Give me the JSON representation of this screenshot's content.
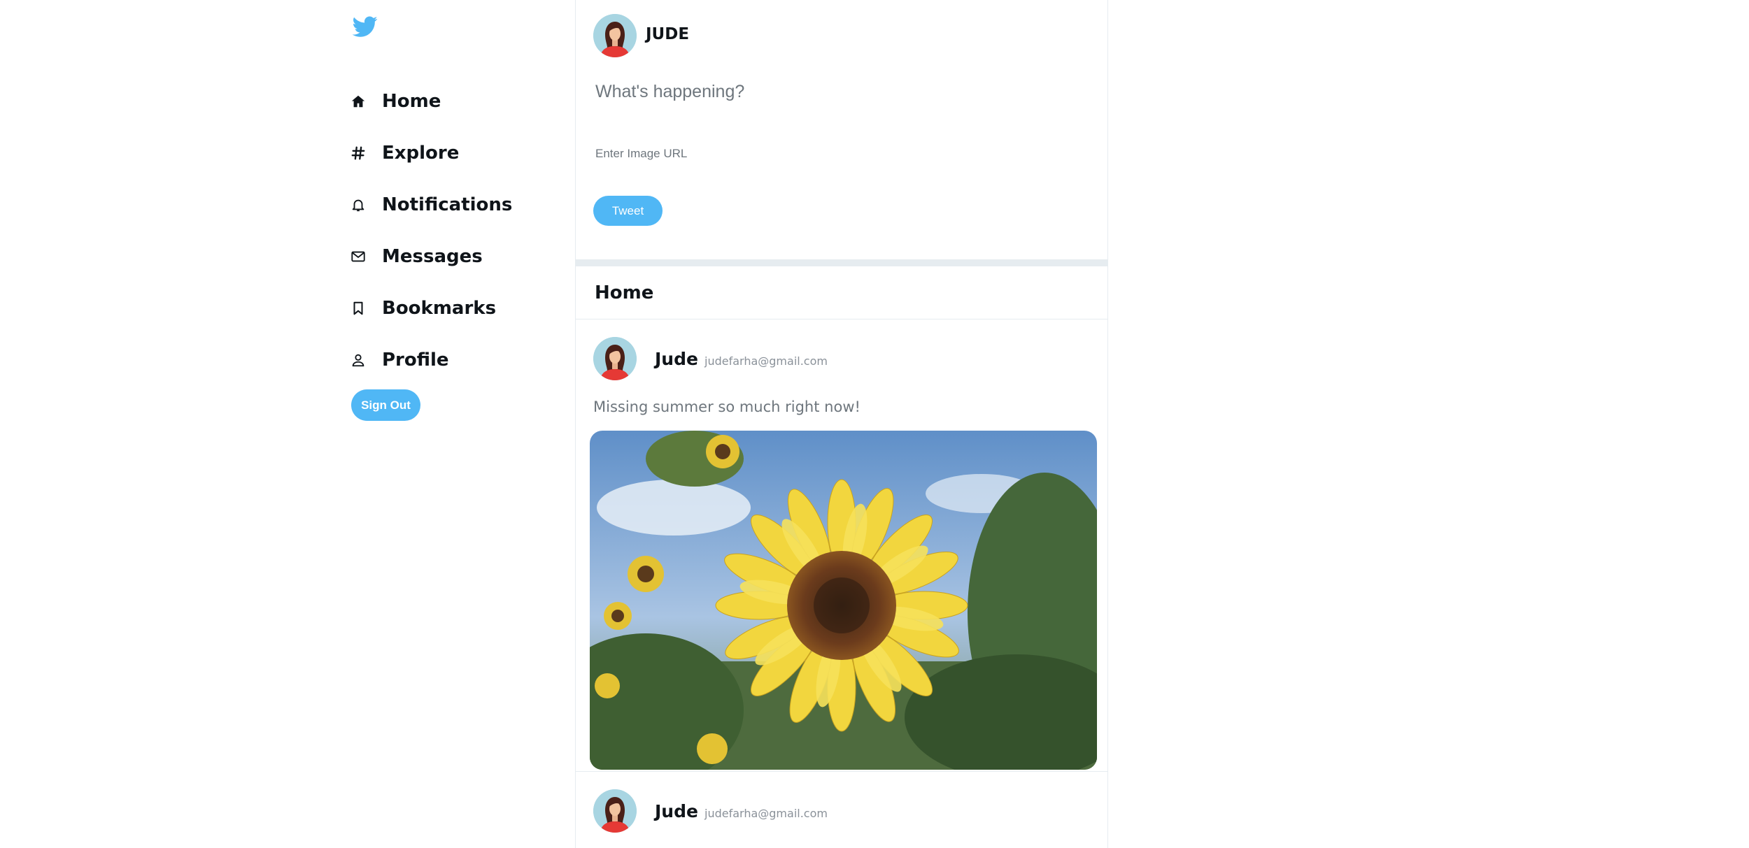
{
  "colors": {
    "accent": "#50b7f5",
    "border": "#e6ecf0",
    "text": "#0f1419",
    "muted": "#6e767d"
  },
  "sidebar": {
    "logo_icon": "twitter-bird-icon",
    "items": [
      {
        "label": "Home",
        "icon": "home-icon"
      },
      {
        "label": "Explore",
        "icon": "hashtag-icon"
      },
      {
        "label": "Notifications",
        "icon": "bell-icon"
      },
      {
        "label": "Messages",
        "icon": "mail-icon"
      },
      {
        "label": "Bookmarks",
        "icon": "bookmark-icon"
      },
      {
        "label": "Profile",
        "icon": "person-icon"
      }
    ],
    "signout_label": "Sign Out"
  },
  "tweetbox": {
    "username": "JUDE",
    "input_placeholder": "What's happening?",
    "image_placeholder": "Enter Image URL",
    "tweet_label": "Tweet"
  },
  "feed": {
    "header_title": "Home",
    "posts": [
      {
        "name": "Jude",
        "email": "judefarha@gmail.com",
        "text": "Missing summer so much right now!",
        "image": "sunflower-photo"
      },
      {
        "name": "Jude",
        "email": "judefarha@gmail.com"
      }
    ]
  }
}
